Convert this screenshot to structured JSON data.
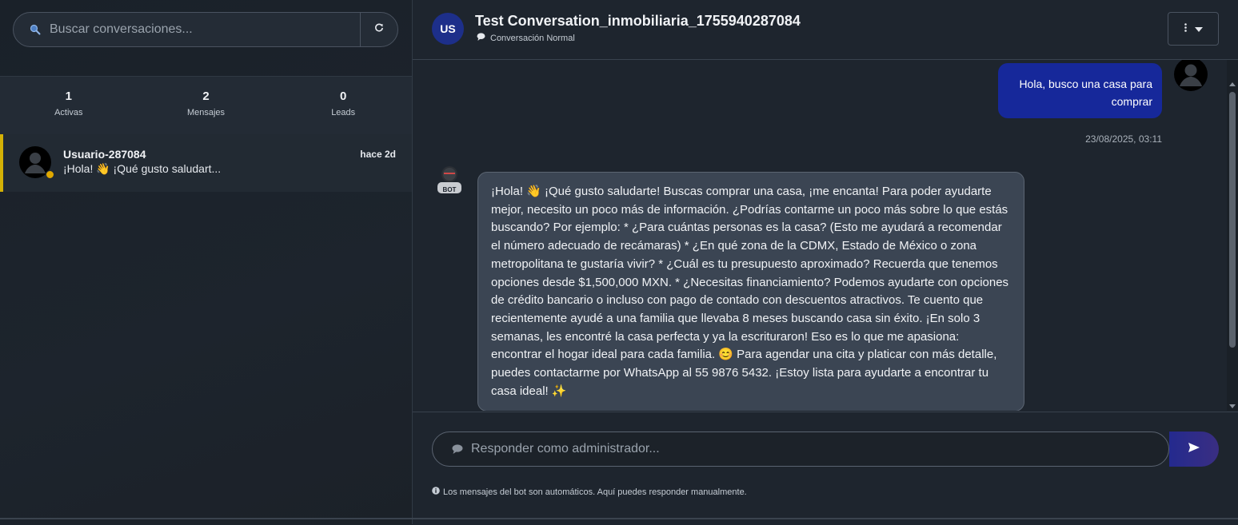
{
  "sidebar": {
    "search": {
      "placeholder": "Buscar conversaciones...",
      "icon": "search-icon"
    },
    "refresh_icon": "refresh-icon",
    "stats": [
      {
        "value": "1",
        "label": "Activas"
      },
      {
        "value": "2",
        "label": "Mensajes"
      },
      {
        "value": "0",
        "label": "Leads"
      }
    ],
    "conversations": [
      {
        "name": "Usuario-287084",
        "time": "hace 2d",
        "preview": "¡Hola! 👋 ¡Qué gusto saludart...",
        "status_color": "#e0a800",
        "accent_color": "#d4b106"
      }
    ]
  },
  "header": {
    "avatar_initials": "US",
    "title": "Test Conversation_inmobiliaria_1755940287084",
    "subtitle": "Conversación Normal",
    "menu_icon": "more-vertical-icon"
  },
  "messages": [
    {
      "from": "user",
      "text": "Hola, busco una casa para comprar",
      "timestamp": "23/08/2025, 03:11"
    },
    {
      "from": "bot",
      "avatar_label": "BOT",
      "text": "¡Hola! 👋 ¡Qué gusto saludarte! Buscas comprar una casa, ¡me encanta! Para poder ayudarte mejor, necesito un poco más de información. ¿Podrías contarme un poco más sobre lo que estás buscando? Por ejemplo: * ¿Para cuántas personas es la casa? (Esto me ayudará a recomendar el número adecuado de recámaras) * ¿En qué zona de la CDMX, Estado de México o zona metropolitana te gustaría vivir? * ¿Cuál es tu presupuesto aproximado? Recuerda que tenemos opciones desde $1,500,000 MXN. * ¿Necesitas financiamiento? Podemos ayudarte con opciones de crédito bancario o incluso con pago de contado con descuentos atractivos. Te cuento que recientemente ayudé a una familia que llevaba 8 meses buscando casa sin éxito. ¡En solo 3 semanas, les encontré la casa perfecta y ya la escrituraron! Eso es lo que me apasiona: encontrar el hogar ideal para cada familia. 😊 Para agendar una cita y platicar con más detalle, puedes contactarme por WhatsApp al 55 9876 5432. ¡Estoy lista para ayudarte a encontrar tu casa ideal! ✨"
    }
  ],
  "composer": {
    "placeholder": "Responder como administrador...",
    "send_icon": "send-icon",
    "note": "Los mensajes del bot son automáticos. Aquí puedes responder manualmente."
  },
  "colors": {
    "user_bubble": "#16289a",
    "bot_bubble": "#3b4553",
    "avatar_us": "#1d2f8a"
  }
}
